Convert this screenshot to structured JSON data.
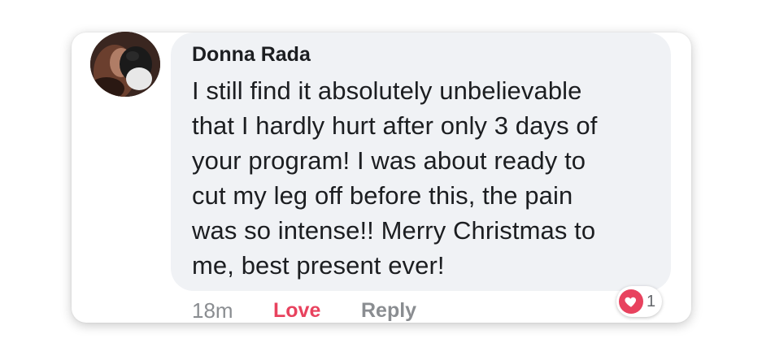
{
  "comment": {
    "author": "Donna Rada",
    "text": "I still find it absolutely unbelievable\nthat I hardly hurt after only 3 days of\nyour program!  I was about ready to\ncut my leg off before this, the pain\nwas so intense!!  Merry Christmas to\nme, best present ever!",
    "avatar_icon": "profile-photo"
  },
  "actions": {
    "timestamp": "18m",
    "love_label": "Love",
    "reply_label": "Reply"
  },
  "reactions": {
    "icon": "heart-icon",
    "count": "1",
    "color": "#e8425e"
  },
  "colors": {
    "bubble": "#f0f2f5",
    "text": "#1c1e21",
    "muted": "#8a8d91",
    "love": "#e8425e"
  }
}
